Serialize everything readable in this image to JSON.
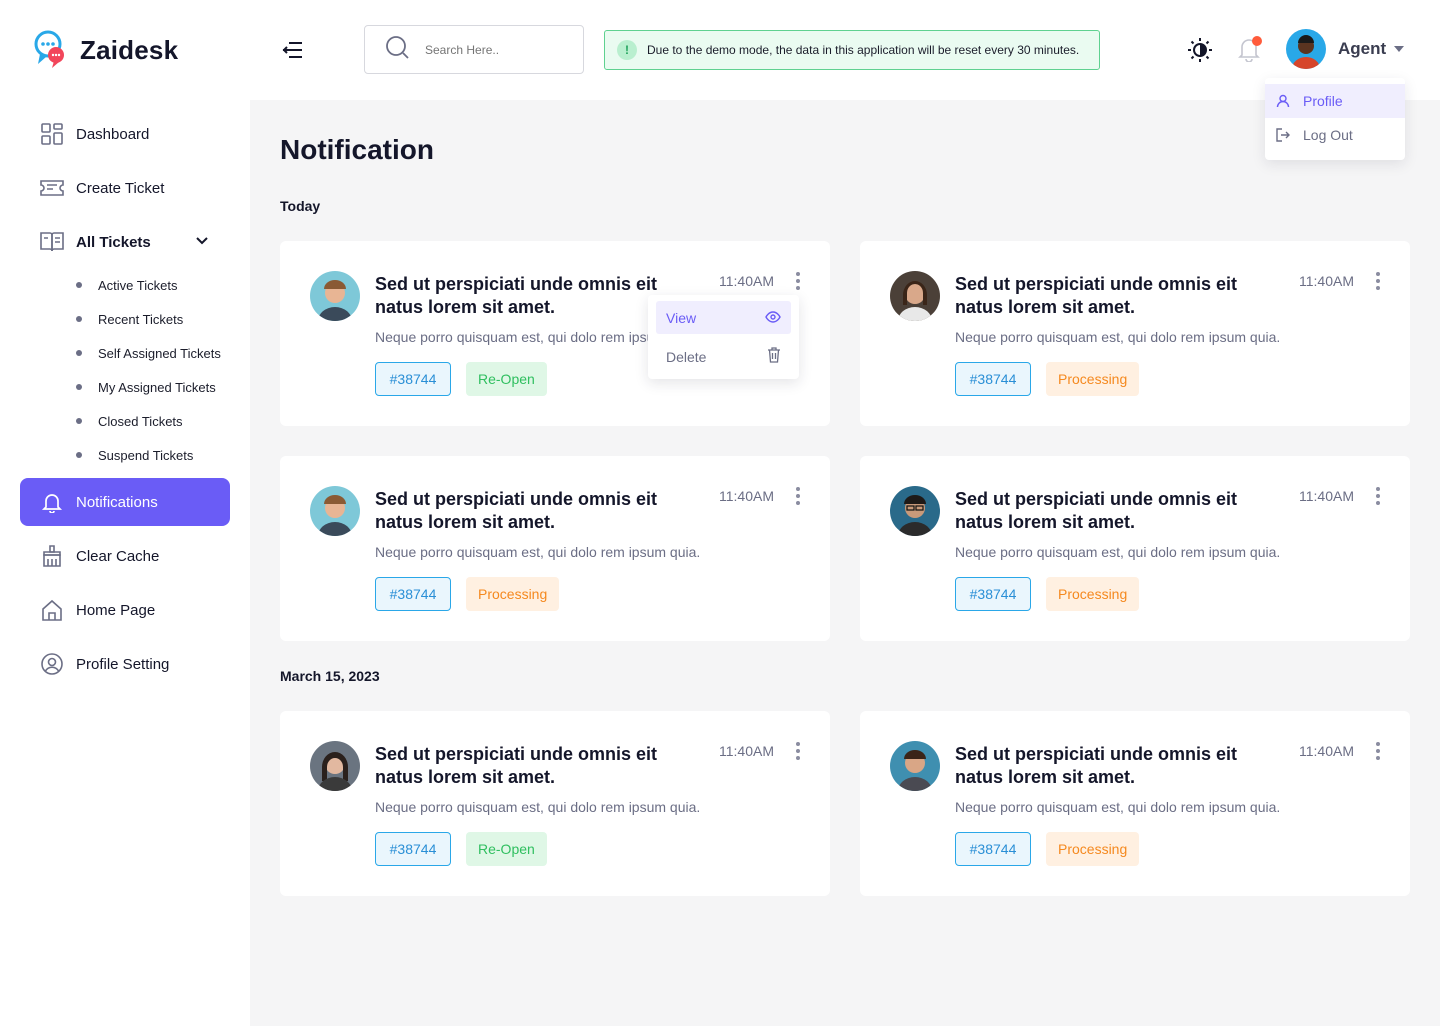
{
  "brand": {
    "name": "Zaidesk"
  },
  "sidebar": {
    "items": [
      {
        "label": "Dashboard",
        "icon": "dashboard-icon"
      },
      {
        "label": "Create Ticket",
        "icon": "ticket-icon"
      },
      {
        "label": "All Tickets",
        "icon": "tickets-list-icon"
      },
      {
        "label": "Notifications",
        "icon": "bell-icon"
      },
      {
        "label": "Clear Cache",
        "icon": "broom-icon"
      },
      {
        "label": "Home Page",
        "icon": "home-icon"
      },
      {
        "label": "Profile Setting",
        "icon": "user-circle-icon"
      }
    ],
    "sub_items": [
      "Active Tickets",
      "Recent Tickets",
      "Self Assigned Tickets",
      "My Assigned Tickets",
      "Closed Tickets",
      "Suspend Tickets"
    ],
    "active_item": "Notifications"
  },
  "header": {
    "search_placeholder": "Search Here..",
    "demo_banner_icon": "!",
    "demo_banner": "Due to the demo mode, the data in this application will be reset every 30 minutes.",
    "user_name": "Agent",
    "user_menu": [
      "Profile",
      "Log Out"
    ]
  },
  "page": {
    "title": "Notification",
    "groups": [
      {
        "label": "Today",
        "cards": [
          {
            "title": "Sed ut perspiciati unde omnis eit natus lorem sit amet.",
            "time": "11:40AM",
            "desc": "Neque porro quisquam est, qui dolo rem ipsum quia.",
            "ticket": "#38744",
            "status": "Re-Open",
            "avatar": "avatar-man-1"
          },
          {
            "title": "Sed ut perspiciati unde omnis eit natus lorem sit amet.",
            "time": "11:40AM",
            "desc": "Neque porro quisquam est, qui dolo rem ipsum quia.",
            "ticket": "#38744",
            "status": "Processing",
            "avatar": "avatar-woman-1"
          },
          {
            "title": "Sed ut perspiciati unde omnis eit natus lorem sit amet.",
            "time": "11:40AM",
            "desc": "Neque porro quisquam est, qui dolo rem ipsum quia.",
            "ticket": "#38744",
            "status": "Processing",
            "avatar": "avatar-man-1"
          },
          {
            "title": "Sed ut perspiciati unde omnis eit natus lorem sit amet.",
            "time": "11:40AM",
            "desc": "Neque porro quisquam est, qui dolo rem ipsum quia.",
            "ticket": "#38744",
            "status": "Processing",
            "avatar": "avatar-man-2"
          }
        ]
      },
      {
        "label": "March 15, 2023",
        "cards": [
          {
            "title": "Sed ut perspiciati unde omnis eit natus lorem sit amet.",
            "time": "11:40AM",
            "desc": "Neque porro quisquam est, qui dolo rem ipsum quia.",
            "ticket": "#38744",
            "status": "Re-Open",
            "avatar": "avatar-woman-2"
          },
          {
            "title": "Sed ut perspiciati unde omnis eit natus lorem sit amet.",
            "time": "11:40AM",
            "desc": "Neque porro quisquam est, qui dolo rem ipsum quia.",
            "ticket": "#38744",
            "status": "Processing",
            "avatar": "avatar-man-3"
          }
        ]
      }
    ],
    "card_menu": {
      "view": "View",
      "delete": "Delete"
    }
  },
  "colors": {
    "accent": "#6a5cf6",
    "reopen": "#2fbf5f",
    "processing": "#f5891f",
    "ticket": "#2a8fd6"
  }
}
